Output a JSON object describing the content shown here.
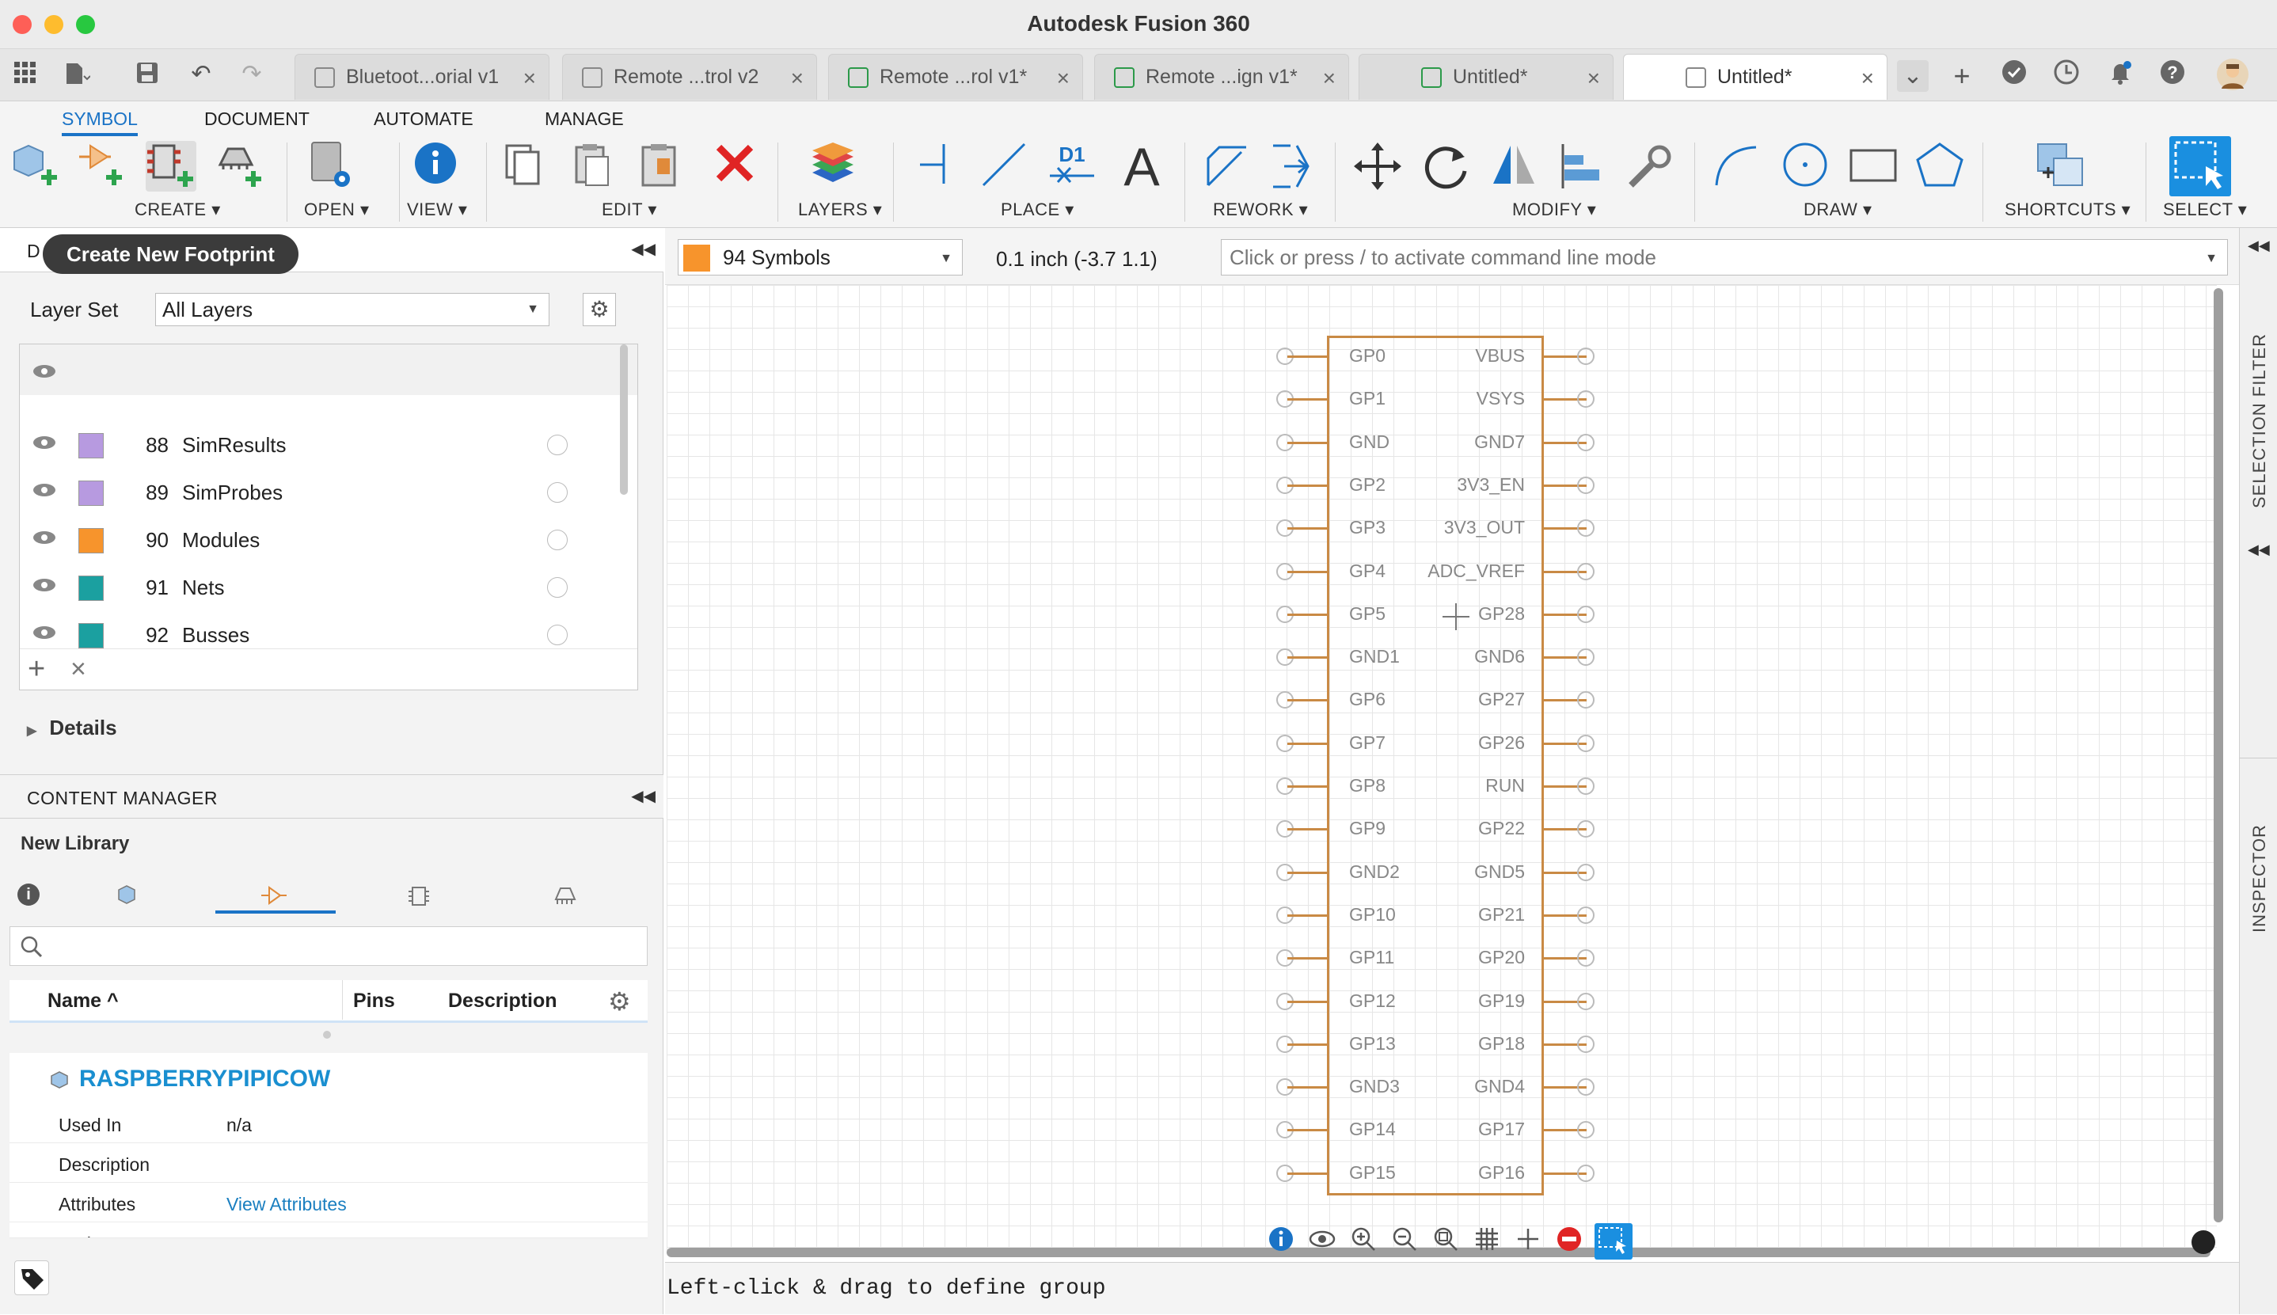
{
  "app": {
    "title": "Autodesk Fusion 360"
  },
  "tabs": [
    {
      "label": "Bluetoot...orial v1"
    },
    {
      "label": "Remote ...trol v2"
    },
    {
      "label": "Remote ...rol v1*"
    },
    {
      "label": "Remote ...ign v1*"
    },
    {
      "label": "Untitled*"
    },
    {
      "label": "Untitled*"
    }
  ],
  "ribbon": {
    "tabs": [
      "SYMBOL",
      "DOCUMENT",
      "AUTOMATE",
      "MANAGE"
    ],
    "groups": {
      "create": "CREATE ▾",
      "open": "OPEN ▾",
      "view": "VIEW ▾",
      "edit": "EDIT ▾",
      "layers": "LAYERS ▾",
      "place": "PLACE ▾",
      "rework": "REWORK ▾",
      "modify": "MODIFY ▾",
      "draw": "DRAW ▾",
      "shortcuts": "SHORTCUTS ▾",
      "select": "SELECT ▾"
    },
    "place_d1": "D1",
    "place_text": "A"
  },
  "tooltip": "Create New Footprint",
  "design_panel": {
    "header_letter": "D",
    "layer_set_label": "Layer Set",
    "layer_set_value": "All Layers",
    "layers": [
      {
        "num": "88",
        "name": "SimResults",
        "color": "#b79ae0"
      },
      {
        "num": "89",
        "name": "SimProbes",
        "color": "#b79ae0"
      },
      {
        "num": "90",
        "name": "Modules",
        "color": "#f7942c"
      },
      {
        "num": "91",
        "name": "Nets",
        "color": "#1ba0a0"
      },
      {
        "num": "92",
        "name": "Busses",
        "color": "#1ba0a0"
      }
    ],
    "details_label": "Details"
  },
  "content_manager": {
    "header": "CONTENT MANAGER",
    "library": "New Library",
    "columns": [
      "Name ^",
      "Pins",
      "Description"
    ],
    "part_name": "RASPBERRYPIPICOW",
    "props": [
      {
        "key": "Used In",
        "value": "n/a"
      },
      {
        "key": "Description",
        "value": ""
      },
      {
        "key": "Attributes",
        "value": "View Attributes"
      },
      {
        "key": "Pads",
        "value": ""
      }
    ]
  },
  "toolbar2": {
    "layer_value": "94 Symbols",
    "layer_color": "#f7942c",
    "coord": "0.1 inch (-3.7 1.1)",
    "cmd_placeholder": "Click or press / to activate command line mode"
  },
  "side_tabs": {
    "selection_filter": "SELECTION FILTER",
    "inspector": "INSPECTOR"
  },
  "symbol": {
    "left_pins": [
      "GP0",
      "GP1",
      "GND",
      "GP2",
      "GP3",
      "GP4",
      "GP5",
      "GND1",
      "GP6",
      "GP7",
      "GP8",
      "GP9",
      "GND2",
      "GP10",
      "GP11",
      "GP12",
      "GP13",
      "GND3",
      "GP14",
      "GP15"
    ],
    "right_pins": [
      "VBUS",
      "VSYS",
      "GND7",
      "3V3_EN",
      "3V3_OUT",
      "ADC_VREF",
      "GP28",
      "GND6",
      "GP27",
      "GP26",
      "RUN",
      "GP22",
      "GND5",
      "GP21",
      "GP20",
      "GP19",
      "GP18",
      "GND4",
      "GP17",
      "GP16"
    ]
  },
  "status": "Left-click & drag to define group"
}
